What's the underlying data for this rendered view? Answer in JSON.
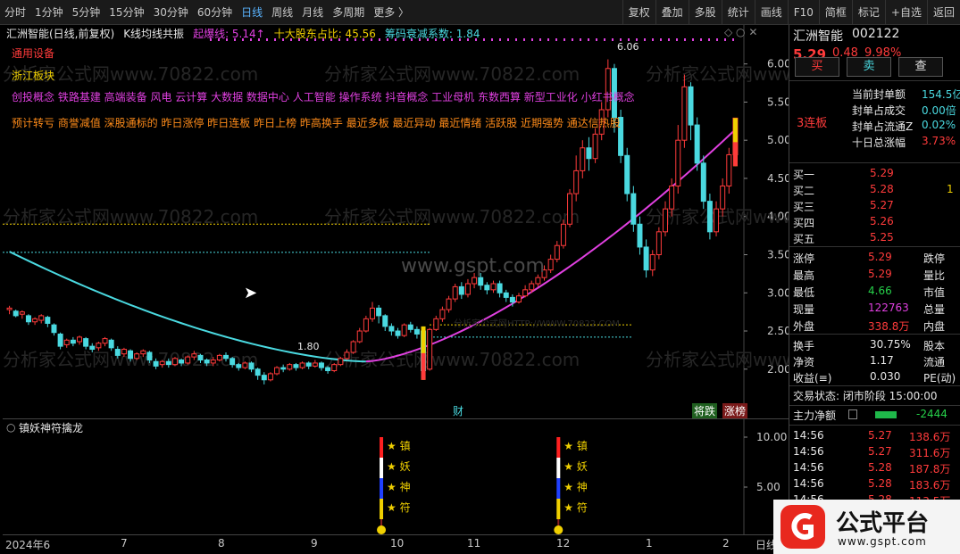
{
  "toolbar": {
    "tabs": [
      "分时",
      "1分钟",
      "5分钟",
      "15分钟",
      "30分钟",
      "60分钟",
      "日线",
      "周线",
      "月线",
      "多周期",
      "更多 〉"
    ],
    "active_tab": 6,
    "buttons": [
      "复权",
      "叠加",
      "多股",
      "统计",
      "画线",
      "F10",
      "简框",
      "标记",
      "+自选",
      "返回"
    ]
  },
  "chart": {
    "info": {
      "name": "汇洲智能(日线,前复权)",
      "indicator": "K线均线共振",
      "burst_label": "起爆线: 5.14↑",
      "holder_label": "十大股东占比: 45.56",
      "chip_label": "筹码衰减系数: 1.84"
    },
    "tags": {
      "line1": "通用设备",
      "line2": "浙江板块",
      "concepts": "创投概念 铁路基建 高端装备 风电 云计算 大数据 数据中心 人工智能 操作系统 抖音概念 工业母机 东数西算 新型工业化 小红书概念",
      "hot": "预计转亏 商誉减值 深股通标的 昨日涨停 昨日连板 昨日上榜 昨高换手 最近多板 最近异动 最近情绪 活跃股 近期强势 通达信热股"
    },
    "price_axis": [
      "6.00",
      "5.50",
      "5.00",
      "4.50",
      "4.00",
      "3.50",
      "3.00",
      "2.50",
      "2.00"
    ],
    "high_mark": "6.06",
    "low_mark": "1.80",
    "watermark_site": "www.gspt.com",
    "watermark_repeat": "分析家公式网www.70822.com",
    "watermark_small": "分析家公式网HTTP://WWW.70822.COM",
    "badges": {
      "cai": "财",
      "jiang": "将跌",
      "zhang": "涨榜"
    }
  },
  "chart_data": {
    "type": "candlestick",
    "price_range": [
      1.6,
      6.3
    ],
    "candles": [
      [
        2.78,
        2.8,
        2.72,
        2.83
      ],
      [
        2.76,
        2.7,
        2.68,
        2.78
      ],
      [
        2.72,
        2.75,
        2.66,
        2.77
      ],
      [
        2.7,
        2.62,
        2.58,
        2.72
      ],
      [
        2.62,
        2.66,
        2.58,
        2.68
      ],
      [
        2.64,
        2.7,
        2.6,
        2.72
      ],
      [
        2.68,
        2.6,
        2.55,
        2.7
      ],
      [
        2.58,
        2.48,
        2.44,
        2.6
      ],
      [
        2.46,
        2.3,
        2.26,
        2.48
      ],
      [
        2.32,
        2.38,
        2.28,
        2.4
      ],
      [
        2.38,
        2.34,
        2.3,
        2.42
      ],
      [
        2.36,
        2.42,
        2.32,
        2.44
      ],
      [
        2.4,
        2.3,
        2.26,
        2.42
      ],
      [
        2.3,
        2.26,
        2.22,
        2.34
      ],
      [
        2.28,
        2.34,
        2.24,
        2.36
      ],
      [
        2.34,
        2.4,
        2.3,
        2.42
      ],
      [
        2.38,
        2.28,
        2.24,
        2.4
      ],
      [
        2.26,
        2.18,
        2.14,
        2.3
      ],
      [
        2.2,
        2.26,
        2.16,
        2.28
      ],
      [
        2.24,
        2.14,
        2.1,
        2.26
      ],
      [
        2.14,
        2.2,
        2.12,
        2.22
      ],
      [
        2.2,
        2.24,
        2.16,
        2.26
      ],
      [
        2.22,
        2.12,
        2.08,
        2.24
      ],
      [
        2.1,
        2.04,
        2.0,
        2.14
      ],
      [
        2.06,
        2.1,
        2.02,
        2.12
      ],
      [
        2.1,
        2.06,
        2.02,
        2.14
      ],
      [
        2.06,
        2.14,
        2.04,
        2.16
      ],
      [
        2.12,
        2.08,
        2.04,
        2.14
      ],
      [
        2.08,
        2.16,
        2.06,
        2.18
      ],
      [
        2.16,
        2.2,
        2.12,
        2.24
      ],
      [
        2.18,
        2.12,
        2.08,
        2.2
      ],
      [
        2.12,
        2.08,
        2.04,
        2.14
      ],
      [
        2.08,
        2.12,
        2.04,
        2.16
      ],
      [
        2.12,
        2.18,
        2.1,
        2.2
      ],
      [
        2.18,
        2.14,
        2.1,
        2.22
      ],
      [
        2.14,
        2.06,
        2.02,
        2.16
      ],
      [
        2.06,
        2.02,
        1.98,
        2.08
      ],
      [
        2.02,
        2.08,
        2.0,
        2.1
      ],
      [
        2.08,
        2.0,
        1.96,
        2.1
      ],
      [
        2.0,
        1.92,
        1.86,
        2.02
      ],
      [
        1.92,
        1.86,
        1.8,
        1.96
      ],
      [
        1.86,
        1.94,
        1.84,
        1.96
      ],
      [
        1.94,
        2.02,
        1.92,
        2.04
      ],
      [
        2.02,
        2.0,
        1.96,
        2.06
      ],
      [
        2.0,
        2.06,
        1.98,
        2.08
      ],
      [
        2.06,
        2.02,
        1.98,
        2.08
      ],
      [
        2.02,
        2.08,
        2.0,
        2.1
      ],
      [
        2.08,
        2.04,
        2.0,
        2.1
      ],
      [
        2.04,
        2.08,
        2.02,
        2.12
      ],
      [
        2.08,
        2.02,
        1.98,
        2.1
      ],
      [
        2.02,
        1.98,
        1.94,
        2.04
      ],
      [
        1.98,
        2.06,
        1.96,
        2.08
      ],
      [
        2.06,
        2.14,
        2.04,
        2.16
      ],
      [
        2.14,
        2.22,
        2.12,
        2.26
      ],
      [
        2.22,
        2.36,
        2.2,
        2.38
      ],
      [
        2.36,
        2.5,
        2.34,
        2.54
      ],
      [
        2.5,
        2.66,
        2.48,
        2.7
      ],
      [
        2.66,
        2.8,
        2.62,
        2.88
      ],
      [
        2.8,
        2.7,
        2.6,
        2.84
      ],
      [
        2.7,
        2.56,
        2.5,
        2.72
      ],
      [
        2.56,
        2.5,
        2.44,
        2.6
      ],
      [
        2.5,
        2.44,
        2.4,
        2.54
      ],
      [
        2.44,
        2.58,
        2.42,
        2.6
      ],
      [
        2.58,
        2.52,
        2.48,
        2.62
      ],
      [
        2.52,
        2.46,
        2.4,
        2.56
      ],
      [
        2.5,
        1.98,
        1.86,
        2.56
      ],
      [
        2.0,
        2.52,
        1.98,
        2.54
      ],
      [
        2.52,
        2.66,
        2.5,
        2.7
      ],
      [
        2.66,
        2.78,
        2.62,
        2.82
      ],
      [
        2.78,
        2.92,
        2.74,
        2.96
      ],
      [
        2.92,
        3.08,
        2.88,
        3.12
      ],
      [
        3.08,
        2.98,
        2.92,
        3.14
      ],
      [
        2.98,
        3.12,
        2.94,
        3.18
      ],
      [
        3.12,
        3.2,
        3.06,
        3.26
      ],
      [
        3.2,
        3.1,
        3.04,
        3.26
      ],
      [
        3.1,
        3.04,
        2.98,
        3.14
      ],
      [
        3.04,
        3.12,
        3.0,
        3.16
      ],
      [
        3.12,
        3.0,
        2.94,
        3.16
      ],
      [
        3.0,
        2.94,
        2.88,
        3.04
      ],
      [
        2.94,
        2.88,
        2.82,
        2.98
      ],
      [
        2.88,
        2.96,
        2.86,
        3.0
      ],
      [
        2.96,
        3.04,
        2.94,
        3.1
      ],
      [
        3.04,
        3.12,
        3.0,
        3.16
      ],
      [
        3.12,
        3.2,
        3.08,
        3.24
      ],
      [
        3.2,
        3.3,
        3.16,
        3.36
      ],
      [
        3.3,
        3.44,
        3.26,
        3.5
      ],
      [
        3.44,
        3.62,
        3.4,
        3.68
      ],
      [
        3.62,
        3.9,
        3.58,
        3.96
      ],
      [
        3.9,
        4.3,
        3.86,
        4.36
      ],
      [
        4.3,
        4.6,
        4.2,
        4.8
      ],
      [
        4.6,
        4.9,
        4.5,
        5.0
      ],
      [
        4.9,
        4.76,
        4.6,
        5.04
      ],
      [
        4.76,
        5.08,
        4.7,
        5.16
      ],
      [
        5.08,
        5.4,
        5.0,
        5.5
      ],
      [
        5.4,
        5.94,
        5.3,
        6.06
      ],
      [
        5.94,
        5.3,
        5.1,
        6.0
      ],
      [
        5.3,
        4.8,
        4.7,
        5.4
      ],
      [
        4.8,
        4.3,
        4.2,
        4.9
      ],
      [
        4.3,
        3.9,
        3.8,
        4.4
      ],
      [
        3.9,
        3.6,
        3.5,
        4.0
      ],
      [
        3.6,
        3.3,
        3.2,
        3.7
      ],
      [
        3.3,
        3.5,
        3.22,
        3.56
      ],
      [
        3.5,
        3.8,
        3.44,
        3.86
      ],
      [
        3.8,
        4.1,
        3.74,
        4.2
      ],
      [
        4.1,
        4.4,
        4.0,
        4.5
      ],
      [
        4.4,
        5.0,
        4.3,
        5.2
      ],
      [
        5.0,
        5.7,
        4.9,
        5.86
      ],
      [
        5.7,
        5.2,
        5.0,
        5.76
      ],
      [
        5.2,
        4.7,
        4.6,
        5.3
      ],
      [
        4.7,
        4.2,
        4.1,
        4.8
      ],
      [
        4.2,
        3.8,
        3.7,
        4.3
      ],
      [
        3.8,
        4.1,
        3.74,
        4.2
      ],
      [
        4.1,
        4.4,
        4.0,
        4.5
      ],
      [
        4.4,
        4.81,
        4.3,
        4.9
      ],
      [
        4.81,
        5.29,
        4.66,
        5.29
      ]
    ],
    "ma_long_range": [
      3.54,
      2.1
    ],
    "ma_short_range": [
      2.1,
      5.14
    ],
    "ref_lines": [
      3.9,
      3.53,
      2.58,
      2.42
    ],
    "sub_axis": [
      "10.00",
      "5.00"
    ]
  },
  "sub": {
    "title": "镇妖神符擒龙",
    "symbols": [
      "★ 镇",
      "★ 妖",
      "★ 神",
      "★ 符"
    ]
  },
  "date_axis": [
    "2024年6",
    "7",
    "8",
    "9",
    "10",
    "11",
    "12",
    "1",
    "2"
  ],
  "date_tail": "日线",
  "panel": {
    "name": "汇洲智能",
    "code": "002122",
    "price": "5.29",
    "change": "0.48",
    "pct": "9.98%",
    "buy_btn": "买",
    "sell_btn": "卖",
    "view_btn": "查",
    "board_tag": "3连板",
    "seal": [
      {
        "label": "当前封单额",
        "value": "154.5亿"
      },
      {
        "label": "封单占成交",
        "value": "0.00倍"
      },
      {
        "label": "封单占流通Z",
        "value": "0.02%"
      },
      {
        "label": "十日总涨幅",
        "value": "3.73%"
      }
    ],
    "book": [
      {
        "label": "买一",
        "price": "5.29",
        "vol": ""
      },
      {
        "label": "买二",
        "price": "5.28",
        "vol": "1"
      },
      {
        "label": "买三",
        "price": "5.27",
        "vol": ""
      },
      {
        "label": "买四",
        "price": "5.26",
        "vol": ""
      },
      {
        "label": "买五",
        "price": "5.25",
        "vol": ""
      }
    ],
    "stats": [
      {
        "l1": "涨停",
        "v1": "5.29",
        "l2": "跌停"
      },
      {
        "l1": "最高",
        "v1": "5.29",
        "l2": "量比"
      },
      {
        "l1": "最低",
        "v1": "4.66",
        "l2": "市值"
      },
      {
        "l1": "现量",
        "v1": "122763",
        "l2": "总量"
      },
      {
        "l1": "外盘",
        "v1": "338.8万",
        "l2": "内盘"
      }
    ],
    "stats2": [
      {
        "l1": "换手",
        "v1": "30.75%",
        "l2": "股本"
      },
      {
        "l1": "净资",
        "v1": "1.17",
        "l2": "流通"
      },
      {
        "l1": "收益(≡)",
        "v1": "0.030",
        "l2": "PE(动)"
      }
    ],
    "trade_status": "交易状态: 闭市阶段 15:00:00",
    "main_net_label": "主力净额",
    "main_net_value": "-2444",
    "ticks": [
      {
        "time": "14:56",
        "price": "5.27",
        "vol": "138.6万"
      },
      {
        "time": "14:56",
        "price": "5.27",
        "vol": "311.6万"
      },
      {
        "time": "14:56",
        "price": "5.28",
        "vol": "187.8万"
      },
      {
        "time": "14:56",
        "price": "5.28",
        "vol": "183.6万"
      },
      {
        "time": "14:56",
        "price": "5.28",
        "vol": "113.5万"
      }
    ]
  },
  "logo": {
    "text": "公式平台",
    "url": "www.gspt.com"
  }
}
